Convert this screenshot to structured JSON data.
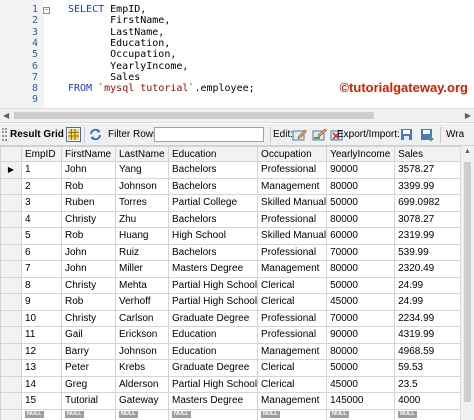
{
  "editor": {
    "lines": [
      {
        "num": "1",
        "fold": "−",
        "parts": [
          {
            "t": "SELECT ",
            "c": "kw"
          },
          {
            "t": "EmpID,",
            "c": ""
          }
        ]
      },
      {
        "num": "2",
        "fold": "",
        "parts": [
          {
            "t": "       FirstName,",
            "c": ""
          }
        ]
      },
      {
        "num": "3",
        "fold": "",
        "parts": [
          {
            "t": "       LastName,",
            "c": ""
          }
        ]
      },
      {
        "num": "4",
        "fold": "",
        "parts": [
          {
            "t": "       Education,",
            "c": ""
          }
        ]
      },
      {
        "num": "5",
        "fold": "",
        "parts": [
          {
            "t": "       Occupation,",
            "c": ""
          }
        ]
      },
      {
        "num": "6",
        "fold": "",
        "parts": [
          {
            "t": "       YearlyIncome,",
            "c": ""
          }
        ]
      },
      {
        "num": "7",
        "fold": "",
        "parts": [
          {
            "t": "       Sales",
            "c": ""
          }
        ]
      },
      {
        "num": "8",
        "fold": "",
        "parts": [
          {
            "t": "FROM ",
            "c": "kw"
          },
          {
            "t": "`mysql tutorial`",
            "c": "str"
          },
          {
            "t": ".employee;",
            "c": ""
          }
        ]
      },
      {
        "num": "9",
        "fold": "",
        "parts": []
      }
    ],
    "watermark": "©tutorialgateway.org"
  },
  "toolbar": {
    "result_grid": "Result Grid",
    "filter_rows": "Filter Rows:",
    "filter_value": "",
    "edit": "Edit:",
    "export_import": "Export/Import:",
    "wrap": "Wra"
  },
  "grid": {
    "columns": [
      "EmpID",
      "FirstName",
      "LastName",
      "Education",
      "Occupation",
      "YearlyIncome",
      "Sales"
    ],
    "rows": [
      [
        "1",
        "John",
        "Yang",
        "Bachelors",
        "Professional",
        "90000",
        "3578.27"
      ],
      [
        "2",
        "Rob",
        "Johnson",
        "Bachelors",
        "Management",
        "80000",
        "3399.99"
      ],
      [
        "3",
        "Ruben",
        "Torres",
        "Partial College",
        "Skilled Manual",
        "50000",
        "699.0982"
      ],
      [
        "4",
        "Christy",
        "Zhu",
        "Bachelors",
        "Professional",
        "80000",
        "3078.27"
      ],
      [
        "5",
        "Rob",
        "Huang",
        "High School",
        "Skilled Manual",
        "60000",
        "2319.99"
      ],
      [
        "6",
        "John",
        "Ruiz",
        "Bachelors",
        "Professional",
        "70000",
        "539.99"
      ],
      [
        "7",
        "John",
        "Miller",
        "Masters Degree",
        "Management",
        "80000",
        "2320.49"
      ],
      [
        "8",
        "Christy",
        "Mehta",
        "Partial High School",
        "Clerical",
        "50000",
        "24.99"
      ],
      [
        "9",
        "Rob",
        "Verhoff",
        "Partial High School",
        "Clerical",
        "45000",
        "24.99"
      ],
      [
        "10",
        "Christy",
        "Carlson",
        "Graduate Degree",
        "Professional",
        "70000",
        "2234.99"
      ],
      [
        "11",
        "Gail",
        "Erickson",
        "Education",
        "Professional",
        "90000",
        "4319.99"
      ],
      [
        "12",
        "Barry",
        "Johnson",
        "Education",
        "Management",
        "80000",
        "4968.59"
      ],
      [
        "13",
        "Peter",
        "Krebs",
        "Graduate Degree",
        "Clerical",
        "50000",
        "59.53"
      ],
      [
        "14",
        "Greg",
        "Alderson",
        "Partial High School",
        "Clerical",
        "45000",
        "23.5"
      ],
      [
        "15",
        "Tutorial",
        "Gateway",
        "Masters Degree",
        "Management",
        "145000",
        "4000"
      ]
    ],
    "null_label": "NULL",
    "current_row_marker": "▶"
  }
}
